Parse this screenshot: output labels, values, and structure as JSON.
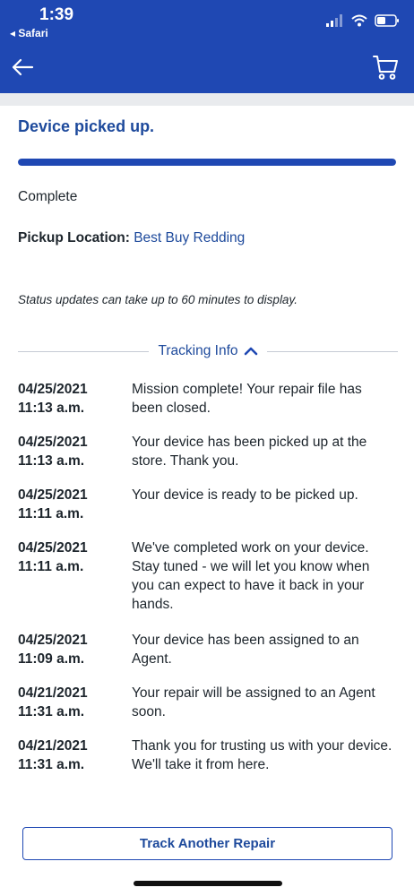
{
  "status_bar": {
    "time": "1:39",
    "back_app": "◂ Safari"
  },
  "header": {
    "back_icon": "arrow-left-icon",
    "cart_icon": "cart-icon"
  },
  "repair": {
    "title": "Device picked up.",
    "progress": 1.0,
    "state": "Complete",
    "pickup_label": "Pickup Location:",
    "pickup_location": "Best Buy Redding",
    "note": "Status updates can take up to 60 minutes to display."
  },
  "tracking": {
    "label": "Tracking Info",
    "events": [
      {
        "date": "04/25/2021",
        "time": "11:13 a.m.",
        "message": "Mission complete! Your repair file has been closed."
      },
      {
        "date": "04/25/2021",
        "time": "11:13 a.m.",
        "message": "Your device has been picked up at the store. Thank you."
      },
      {
        "date": "04/25/2021",
        "time": "11:11 a.m.",
        "message": "Your device is ready to be picked up."
      },
      {
        "date": "04/25/2021",
        "time": "11:11 a.m.",
        "message": "We've completed work on your device. Stay tuned - we will let you know when you can expect to have it back in your hands."
      },
      {
        "date": "04/25/2021",
        "time": "11:09 a.m.",
        "message": "Your device has been assigned to an Agent."
      },
      {
        "date": "04/21/2021",
        "time": "11:31 a.m.",
        "message": "Your repair will be assigned to an Agent soon."
      },
      {
        "date": "04/21/2021",
        "time": "11:31 a.m.",
        "message": "Thank you for trusting us with your device. We'll take it from here."
      }
    ]
  },
  "footer": {
    "track_button": "Track Another Repair"
  },
  "colors": {
    "brand_blue": "#1f48b3",
    "link_blue": "#1e4a9c"
  }
}
